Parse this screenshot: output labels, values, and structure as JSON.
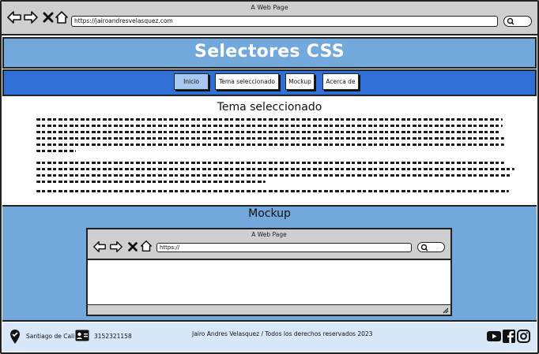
{
  "browser": {
    "title": "A Web Page",
    "url": "https://jairoandresvelasquez.com"
  },
  "header": {
    "title": "Selectores CSS"
  },
  "nav": {
    "items": [
      {
        "label": "Inicio",
        "active": true
      },
      {
        "label": "Tema seleccionado",
        "active": false
      },
      {
        "label": "Mockup",
        "active": false
      },
      {
        "label": "Acerca de",
        "active": false
      }
    ]
  },
  "topic": {
    "title": "Tema seleccionado"
  },
  "mockup": {
    "title": "Mockup",
    "browser_title": "A Web Page",
    "url": "https://"
  },
  "footer": {
    "location": "Santiago de Cali",
    "phone": "3152321158",
    "copyright": "Jairo Andres Velasquez / Todos los derechos reservados 2023"
  },
  "colors": {
    "header_bg": "#73a8dc",
    "nav_bg": "#2f6fd6",
    "footer_bg": "#d8e8f8",
    "chrome_bg": "#cfcfcf"
  }
}
